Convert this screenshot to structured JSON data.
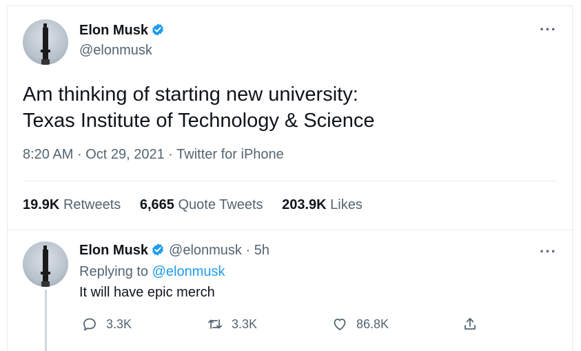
{
  "tweet": {
    "author_name": "Elon Musk",
    "author_handle": "@elonmusk",
    "text_line1": "Am thinking of starting new university:",
    "text_line2": "Texas Institute of Technology & Science",
    "time": "8:20 AM",
    "date": "Oct 29, 2021",
    "source": "Twitter for iPhone",
    "separator": "·",
    "more": "···",
    "stats": {
      "retweets_count": "19.9K",
      "retweets_label": "Retweets",
      "quotes_count": "6,665",
      "quotes_label": "Quote Tweets",
      "likes_count": "203.9K",
      "likes_label": "Likes"
    }
  },
  "reply": {
    "author_name": "Elon Musk",
    "author_handle": "@elonmusk",
    "separator": "·",
    "age": "5h",
    "replying_prefix": "Replying to",
    "replying_to": "@elonmusk",
    "text": "It will have epic merch",
    "more": "···",
    "actions": {
      "reply_count": "3.3K",
      "retweet_count": "3.3K",
      "like_count": "86.8K"
    }
  },
  "icons": {
    "verified": "verified-badge-icon",
    "reply": "comment-bubble-icon",
    "retweet": "retweet-arrows-icon",
    "like": "heart-icon",
    "share": "share-upload-icon"
  },
  "colors": {
    "accent": "#1d9bf0",
    "text_primary": "#0f1419",
    "text_secondary": "#536471",
    "divider": "#e6ecf0"
  }
}
